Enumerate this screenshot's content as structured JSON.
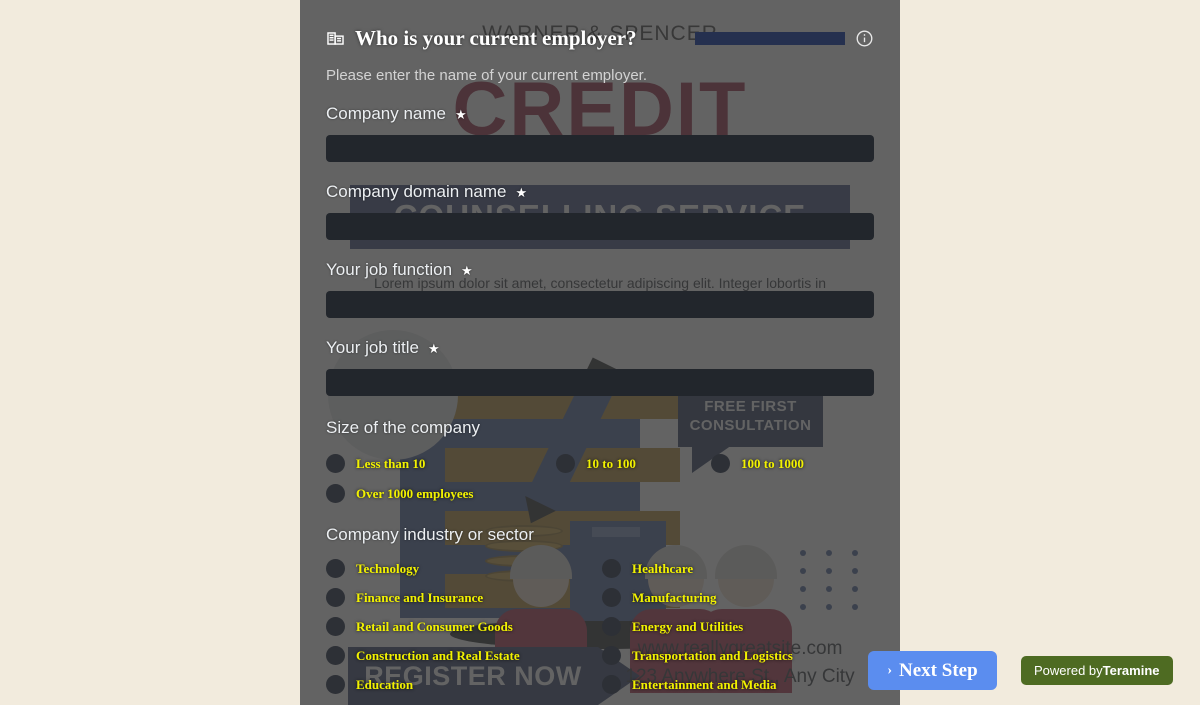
{
  "background_poster": {
    "firm_name": "WARNER & SPENCER",
    "headline": "CREDIT",
    "band_text": "COUNSELLING SERVICE",
    "body_text": "Lorem ipsum dolor sit amet, consectetur adipiscing elit. Integer lobortis in turpis. Nulla interdum aliquam",
    "badge_text": "FREE FIRST CONSULTATION",
    "cta_text": "REGISTER NOW",
    "website": "www.reallygreatsite.com",
    "address": "123 Anywhere St., Any City",
    "colors": {
      "headline_red": "#8e1230",
      "band_blue": "#2c3b6e",
      "gold": "#b08424",
      "navy": "#14274e"
    }
  },
  "modal": {
    "title_icon": "company-building-icon",
    "title": "Who is your current employer?",
    "subtitle": "Please enter the name of your current employer.",
    "info_icon": "info-icon",
    "progress": {
      "percent": 100,
      "fill_color": "#25304f"
    },
    "fields": [
      {
        "label": "Company name",
        "required_marker": "★",
        "value": "",
        "placeholder": ""
      },
      {
        "label": "Company domain name",
        "required_marker": "★",
        "value": "",
        "placeholder": ""
      },
      {
        "label": "Your job function",
        "required_marker": "★",
        "value": "",
        "placeholder": ""
      },
      {
        "label": "Your job title",
        "required_marker": "★",
        "value": "",
        "placeholder": ""
      }
    ],
    "size_group": {
      "title": "Size of the company",
      "options": [
        "Less than 10",
        "10 to 100",
        "100 to 1000",
        "Over 1000 employees"
      ]
    },
    "industry_group": {
      "title": "Company industry or sector",
      "options_left": [
        "Technology",
        "Finance and Insurance",
        "Retail and Consumer Goods",
        "Construction and Real Estate",
        "Education"
      ],
      "options_right": [
        "Healthcare",
        "Manufacturing",
        "Energy and Utilities",
        "Transportation and Logistics",
        "Entertainment and Media"
      ]
    },
    "option_label_color": "#f2f200"
  },
  "footer": {
    "next_step_chevron": "›",
    "next_step_label": "Next Step",
    "powered_prefix": "Powered by",
    "powered_brand": "Teramine",
    "next_step_color": "#5b8def",
    "powered_color": "#4e6b22"
  }
}
